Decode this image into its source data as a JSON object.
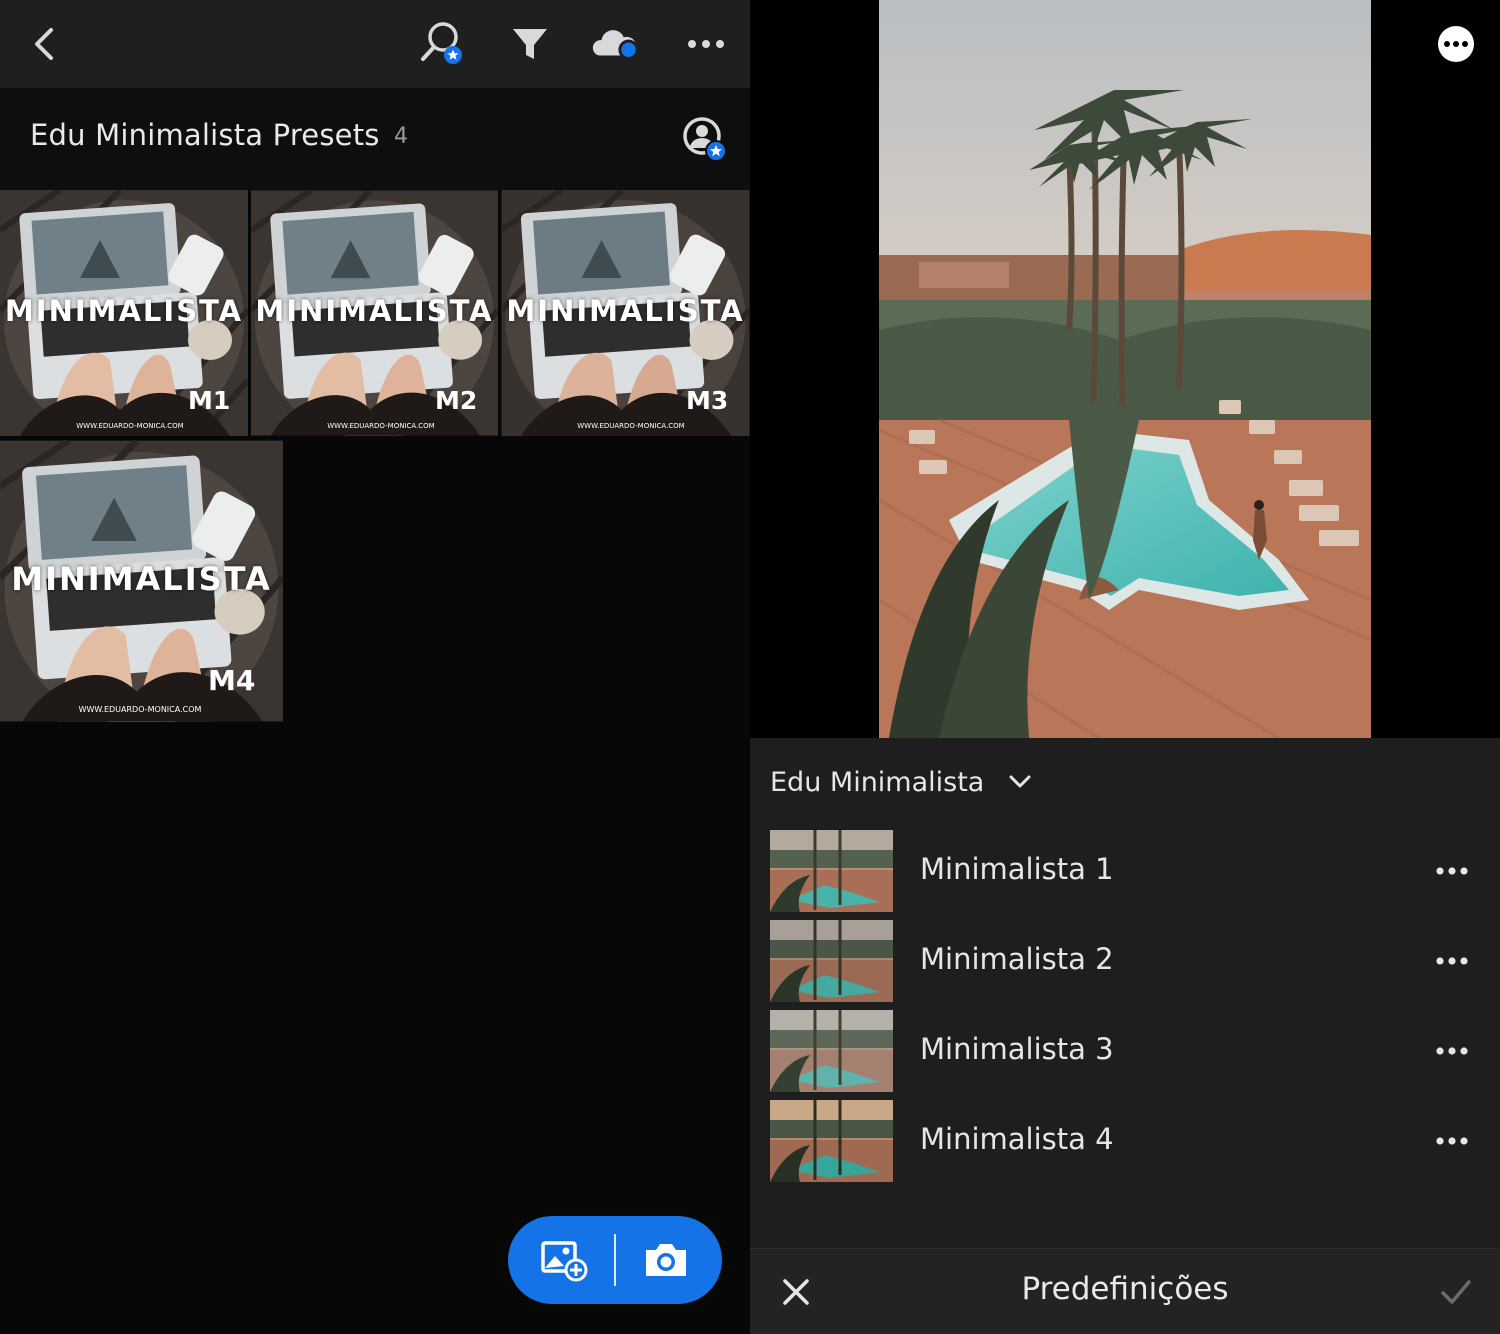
{
  "left": {
    "album": {
      "title": "Edu Minimalista Presets",
      "count": "4"
    },
    "toolbar_icons": [
      "back-icon",
      "search-people-icon",
      "filter-icon",
      "cloud-sync-icon",
      "more-icon"
    ],
    "thumbnails": [
      {
        "overlay_text": "MINIMALISTA",
        "code": "M1",
        "url_text": "WWW.EDUARDO-MONICA.COM"
      },
      {
        "overlay_text": "MINIMALISTA",
        "code": "M2",
        "url_text": "WWW.EDUARDO-MONICA.COM"
      },
      {
        "overlay_text": "MINIMALISTA",
        "code": "M3",
        "url_text": "WWW.EDUARDO-MONICA.COM"
      },
      {
        "overlay_text": "MINIMALISTA",
        "code": "M4",
        "url_text": "WWW.EDUARDO-MONICA.COM"
      }
    ],
    "fab_icons": [
      "add-photo-icon",
      "camera-icon"
    ]
  },
  "right": {
    "preset_group": "Edu Minimalista",
    "presets": [
      {
        "label": "Minimalista 1"
      },
      {
        "label": "Minimalista 2"
      },
      {
        "label": "Minimalista 3"
      },
      {
        "label": "Minimalista 4"
      }
    ],
    "bottom_title": "Predefinições"
  },
  "colors": {
    "accent_blue": "#1473e6",
    "topbar": "#1f1f1f",
    "panel": "#1e1e1e"
  }
}
